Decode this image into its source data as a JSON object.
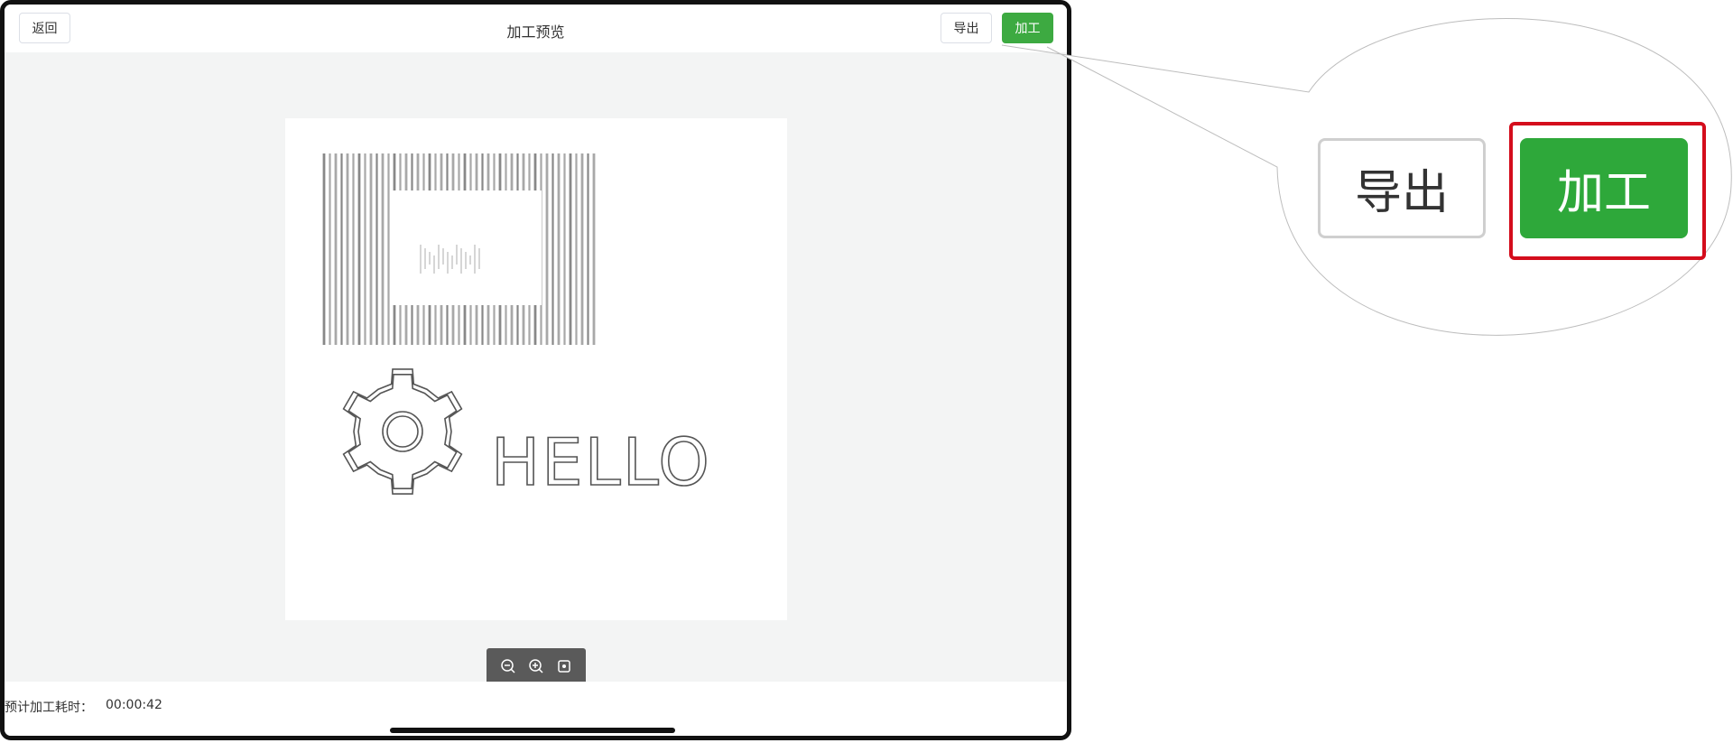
{
  "topbar": {
    "back_label": "返回",
    "title": "加工预览",
    "export_label": "导出",
    "process_label": "加工"
  },
  "preview": {
    "text": "HELLO",
    "icon": "gear-icon"
  },
  "zoom_toolbar": {
    "icons": [
      "zoom-out-icon",
      "zoom-in-icon",
      "fit-view-icon"
    ]
  },
  "footer": {
    "time_label": "预计加工耗时：",
    "time_value": "00:00:42"
  },
  "callout": {
    "export_label": "导出",
    "process_label": "加工"
  },
  "colors": {
    "primary": "#3daa41",
    "highlight": "#d40d1c",
    "canvas_bg": "#f3f4f4"
  }
}
